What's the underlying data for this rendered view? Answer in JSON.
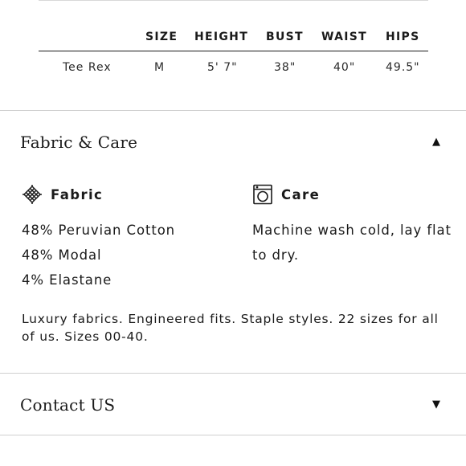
{
  "size_chart": {
    "headers": [
      "SIZE",
      "HEIGHT",
      "BUST",
      "WAIST",
      "HIPS"
    ],
    "rows": [
      {
        "name": "Tee Rex",
        "size": "M",
        "height": "5' 7\"",
        "bust": "38\"",
        "waist": "40\"",
        "hips": "49.5\""
      }
    ]
  },
  "fabric_care": {
    "title": "Fabric & Care",
    "expanded": true,
    "caret_icon": "caret-up-icon",
    "fabric": {
      "label": "Fabric",
      "icon": "fabric-weave-icon",
      "lines": [
        "48% Peruvian Cotton",
        "48% Modal",
        "4% Elastane"
      ]
    },
    "care": {
      "label": "Care",
      "icon": "washing-machine-icon",
      "text": "Machine wash cold, lay flat to dry."
    },
    "blurb": "Luxury fabrics. Engineered fits. Staple styles. 22 sizes for all of us. Sizes 00-40."
  },
  "contact": {
    "title": "Contact US",
    "expanded": false,
    "caret_icon": "caret-down-icon"
  }
}
